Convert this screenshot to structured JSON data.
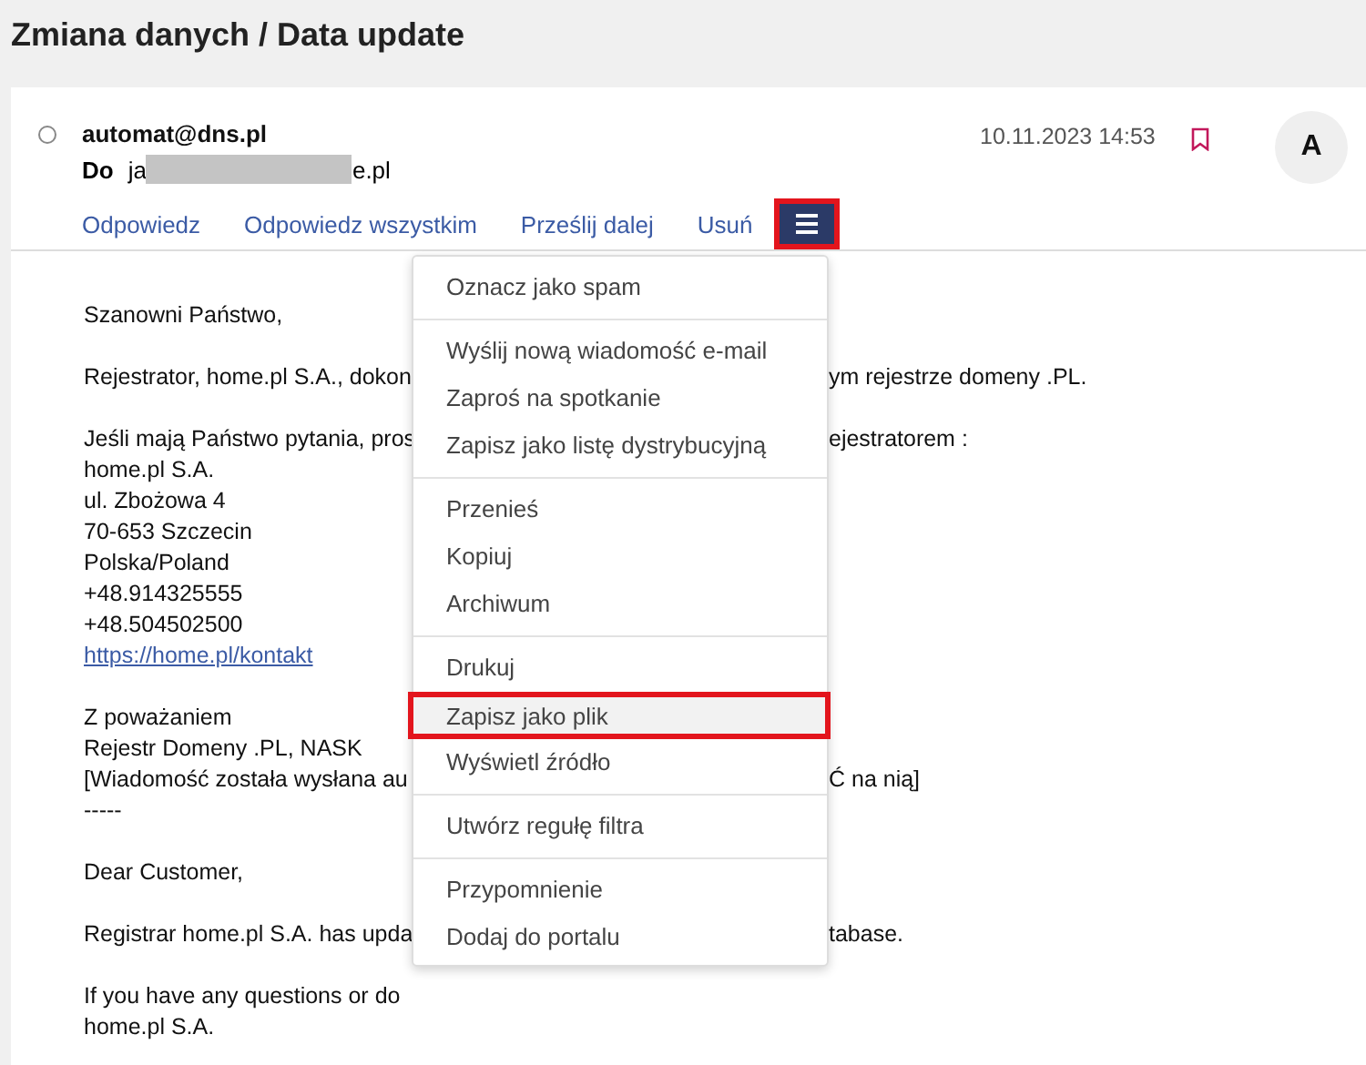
{
  "page_title": "Zmiana danych / Data update",
  "message": {
    "selected": false,
    "sender": "automat@dns.pl",
    "to_label": "Do",
    "recipient_start": "ja",
    "recipient_end": "e.pl",
    "date": "10.11.2023 14:53",
    "flagged": false,
    "avatar": "A"
  },
  "actions": [
    "Odpowiedz",
    "Odpowiedz wszystkim",
    "Prześlij dalej",
    "Usuń"
  ],
  "more_button": {
    "expanded": true,
    "highlighted": true
  },
  "menu_groups": [
    {
      "items": [
        {
          "label": "Oznacz jako spam",
          "hovered": false,
          "highlighted": false
        }
      ]
    },
    {
      "items": [
        {
          "label": "Wyślij nową wiadomość e-mail",
          "hovered": false,
          "highlighted": false
        },
        {
          "label": "Zaproś na spotkanie",
          "hovered": false,
          "highlighted": false
        },
        {
          "label": "Zapisz jako listę dystrybucyjną",
          "hovered": false,
          "highlighted": false
        }
      ]
    },
    {
      "items": [
        {
          "label": "Przenieś",
          "hovered": false,
          "highlighted": false
        },
        {
          "label": "Kopiuj",
          "hovered": false,
          "highlighted": false
        },
        {
          "label": "Archiwum",
          "hovered": false,
          "highlighted": false
        }
      ]
    },
    {
      "items": [
        {
          "label": "Drukuj",
          "hovered": false,
          "highlighted": false
        },
        {
          "label": "Zapisz jako plik",
          "hovered": true,
          "highlighted": true
        },
        {
          "label": "Wyświetl źródło",
          "hovered": false,
          "highlighted": false
        }
      ]
    },
    {
      "items": [
        {
          "label": "Utwórz regułę filtra",
          "hovered": false,
          "highlighted": false
        }
      ]
    },
    {
      "items": [
        {
          "label": "Przypomnienie",
          "hovered": false,
          "highlighted": false
        },
        {
          "label": "Dodaj do portalu",
          "hovered": false,
          "highlighted": false
        }
      ]
    }
  ],
  "body_lines": [
    {
      "kind": "text",
      "left": "Szanowni Państwo,"
    },
    {
      "kind": "blank"
    },
    {
      "kind": "text",
      "left": "Rejestrator, home.pl S.A., dokon",
      "right": "ym rejestrze domeny .PL."
    },
    {
      "kind": "blank"
    },
    {
      "kind": "text",
      "left": "Jeśli mają Państwo pytania, pros",
      "right": "ejestratorem :"
    },
    {
      "kind": "text",
      "left": "home.pl S.A."
    },
    {
      "kind": "text",
      "left": "ul. Zbożowa 4"
    },
    {
      "kind": "text",
      "left": "70-653 Szczecin"
    },
    {
      "kind": "text",
      "left": "Polska/Poland"
    },
    {
      "kind": "text",
      "left": "+48.914325555"
    },
    {
      "kind": "text",
      "left": "+48.504502500"
    },
    {
      "kind": "link",
      "left": "https://home.pl/kontakt"
    },
    {
      "kind": "blank"
    },
    {
      "kind": "text",
      "left": "Z poważaniem"
    },
    {
      "kind": "text",
      "left": "Rejestr Domeny .PL, NASK"
    },
    {
      "kind": "text",
      "left": "[Wiadomość została wysłana au",
      "right": "Ć na nią]"
    },
    {
      "kind": "text",
      "left": "-----"
    },
    {
      "kind": "blank"
    },
    {
      "kind": "text",
      "left": "Dear Customer,"
    },
    {
      "kind": "blank"
    },
    {
      "kind": "text",
      "left": "Registrar home.pl S.A. has upda",
      "right": "tabase."
    },
    {
      "kind": "blank"
    },
    {
      "kind": "text",
      "left": "If you have any questions or do"
    },
    {
      "kind": "text",
      "left": "home.pl S.A."
    }
  ]
}
